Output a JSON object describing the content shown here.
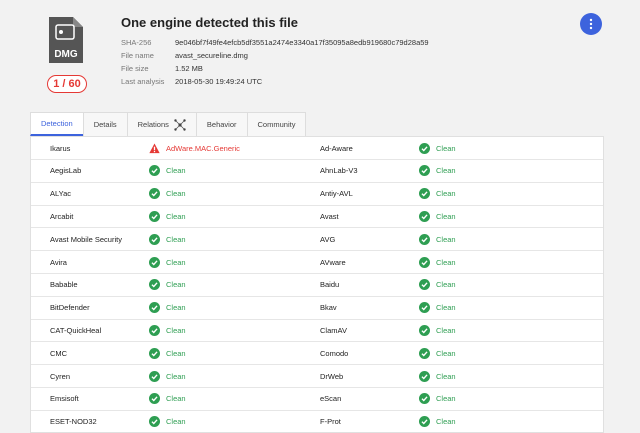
{
  "header": {
    "title": "One engine detected this file",
    "file_type": "DMG",
    "score": "1 / 60",
    "meta": [
      {
        "label": "SHA-256",
        "value": "9e046bf7f49fe4efcb5df3551a2474e3340a17f35095a8edb919680c79d28a59"
      },
      {
        "label": "File name",
        "value": "avast_secureline.dmg"
      },
      {
        "label": "File size",
        "value": "1.52 MB"
      },
      {
        "label": "Last analysis",
        "value": "2018-05-30 19:49:24 UTC"
      }
    ]
  },
  "tabs": [
    {
      "label": "Detection",
      "active": true
    },
    {
      "label": "Details"
    },
    {
      "label": "Relations"
    },
    {
      "label": "Behavior"
    },
    {
      "label": "Community"
    }
  ],
  "detections": [
    [
      {
        "engine": "Ikarus",
        "result": "AdWare.MAC.Generic",
        "status": "malicious"
      },
      {
        "engine": "Ad-Aware",
        "result": "Clean",
        "status": "clean"
      }
    ],
    [
      {
        "engine": "AegisLab",
        "result": "Clean",
        "status": "clean"
      },
      {
        "engine": "AhnLab-V3",
        "result": "Clean",
        "status": "clean"
      }
    ],
    [
      {
        "engine": "ALYac",
        "result": "Clean",
        "status": "clean"
      },
      {
        "engine": "Antiy-AVL",
        "result": "Clean",
        "status": "clean"
      }
    ],
    [
      {
        "engine": "Arcabit",
        "result": "Clean",
        "status": "clean"
      },
      {
        "engine": "Avast",
        "result": "Clean",
        "status": "clean"
      }
    ],
    [
      {
        "engine": "Avast Mobile Security",
        "result": "Clean",
        "status": "clean"
      },
      {
        "engine": "AVG",
        "result": "Clean",
        "status": "clean"
      }
    ],
    [
      {
        "engine": "Avira",
        "result": "Clean",
        "status": "clean"
      },
      {
        "engine": "AVware",
        "result": "Clean",
        "status": "clean"
      }
    ],
    [
      {
        "engine": "Babable",
        "result": "Clean",
        "status": "clean"
      },
      {
        "engine": "Baidu",
        "result": "Clean",
        "status": "clean"
      }
    ],
    [
      {
        "engine": "BitDefender",
        "result": "Clean",
        "status": "clean"
      },
      {
        "engine": "Bkav",
        "result": "Clean",
        "status": "clean"
      }
    ],
    [
      {
        "engine": "CAT-QuickHeal",
        "result": "Clean",
        "status": "clean"
      },
      {
        "engine": "ClamAV",
        "result": "Clean",
        "status": "clean"
      }
    ],
    [
      {
        "engine": "CMC",
        "result": "Clean",
        "status": "clean"
      },
      {
        "engine": "Comodo",
        "result": "Clean",
        "status": "clean"
      }
    ],
    [
      {
        "engine": "Cyren",
        "result": "Clean",
        "status": "clean"
      },
      {
        "engine": "DrWeb",
        "result": "Clean",
        "status": "clean"
      }
    ],
    [
      {
        "engine": "Emsisoft",
        "result": "Clean",
        "status": "clean"
      },
      {
        "engine": "eScan",
        "result": "Clean",
        "status": "clean"
      }
    ],
    [
      {
        "engine": "ESET-NOD32",
        "result": "Clean",
        "status": "clean"
      },
      {
        "engine": "F-Prot",
        "result": "Clean",
        "status": "clean"
      }
    ]
  ],
  "colors": {
    "accent": "#3d63dd",
    "clean": "#2e9e52",
    "malicious": "#e53935"
  }
}
